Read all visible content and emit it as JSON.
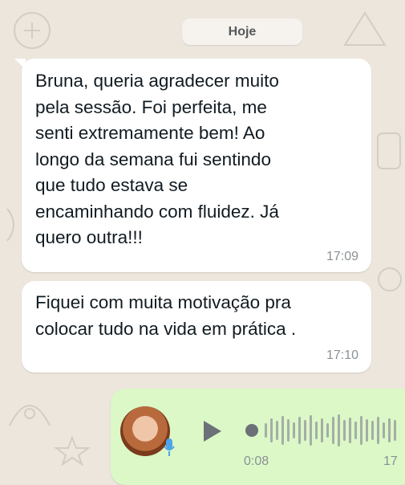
{
  "chat": {
    "date_label": "Hoje",
    "messages": [
      {
        "text": "Bruna, queria agradecer muito\npela sessão. Foi perfeita, me\nsenti extremamente bem! Ao\nlongo da semana fui sentindo\nque tudo estava se\nencaminhando com fluidez. Já\nquero outra!!!",
        "time": "17:09"
      },
      {
        "text": "Fiquei com muita motivação pra\ncolocar tudo na vida em prática .",
        "time": "17:10"
      }
    ],
    "voice_note": {
      "duration": "0:08",
      "time": "17",
      "play_icon": "play-icon",
      "mic_icon": "mic-icon"
    }
  },
  "colors": {
    "background": "#ece6dd",
    "incoming_bubble": "#ffffff",
    "outgoing_bubble": "#dbf8c6",
    "timestamp": "#8a9096",
    "mic_accent": "#4fa3ea"
  }
}
